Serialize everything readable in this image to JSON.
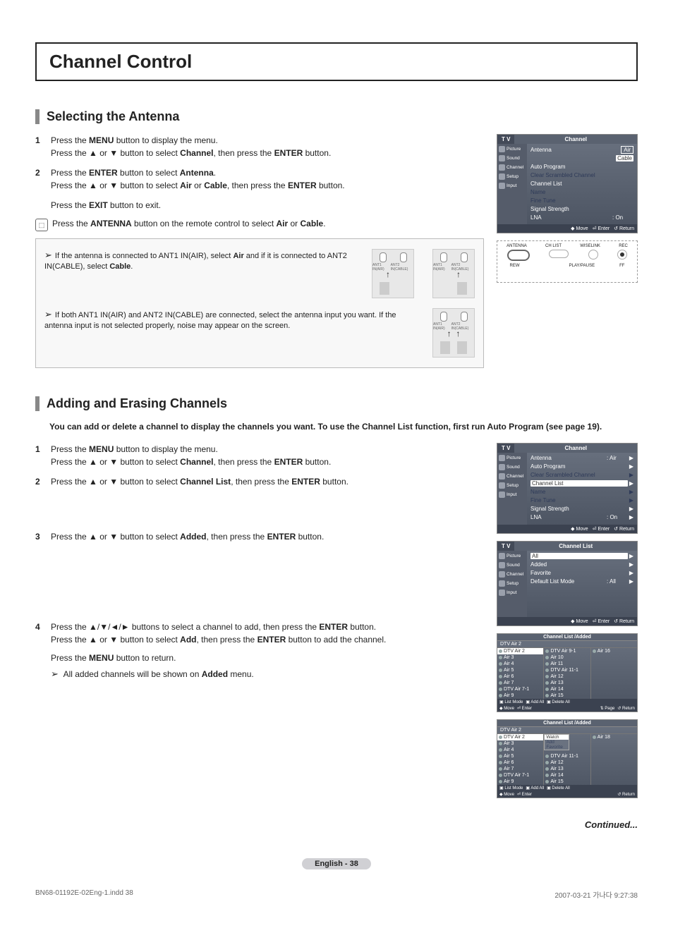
{
  "page": {
    "title": "Channel Control",
    "continued": "Continued...",
    "pagenum": "English - 38",
    "footer_left": "BN68-01192E-02Eng-1.indd   38",
    "footer_right": "2007-03-21   가나다 9:27:38"
  },
  "section1": {
    "heading": "Selecting the Antenna",
    "steps": [
      {
        "n": "1",
        "body": "Press the <b>MENU</b> button to display the menu.<br>Press the ▲ or ▼ button to select <b>Channel</b>, then press the <b>ENTER</b> button."
      },
      {
        "n": "2",
        "body": "Press the <b>ENTER</b> button to select <b>Antenna</b>.<br>Press the ▲ or ▼ button to select <b>Air</b> or <b>Cable</b>, then press the <b>ENTER</b> button."
      }
    ],
    "exit": "Press the <b>EXIT</b> button to exit.",
    "remote_note": "Press the <b>ANTENNA</b> button on the remote control to select <b>Air</b> or <b>Cable</b>.",
    "hint1": "If the antenna is connected to ANT1 IN(AIR), select <b>Air</b> and if it is connected to ANT2 IN(CABLE), select <b>Cable</b>.",
    "hint2": "If both ANT1 IN(AIR) and ANT2 IN(CABLE) are connected, select the antenna input you want. If the antenna input is not selected properly, noise may appear on the screen.",
    "osd": {
      "tv": "T V",
      "title": "Channel",
      "side": [
        "Picture",
        "Sound",
        "Channel",
        "Setup",
        "Input"
      ],
      "antenna": "Antenna",
      "air": "Air",
      "cable": "Cable",
      "autoprog": "Auto Program",
      "clear": "Clear Scrambled Channel",
      "chlist": "Channel List",
      "name": "Name",
      "finetune": "Fine Tune",
      "signal": "Signal Strength",
      "lna": "LNA",
      "on": ": On",
      "foot_move": "Move",
      "foot_enter": "Enter",
      "foot_return": "Return"
    },
    "remote_labels": {
      "ant": "ANTENNA",
      "chlist": "CH LIST",
      "wise": "WISELINK",
      "rec": "REC",
      "rew": "REW",
      "play": "PLAY/PAUSE",
      "ff": "FF"
    },
    "ant1": "ANT1 IN(AIR)",
    "ant2": "ANT2 IN(CABLE)"
  },
  "section2": {
    "heading": "Adding and Erasing Channels",
    "intro": "You can add or delete a channel to display the channels you want. To use the Channel List function, first run Auto Program (see page 19).",
    "steps": [
      {
        "n": "1",
        "body": "Press the <b>MENU</b> button to display the menu.<br>Press the ▲ or ▼ button to select <b>Channel</b>, then press the <b>ENTER</b> button."
      },
      {
        "n": "2",
        "body": "Press the ▲ or ▼ button to select <b>Channel List</b>, then press the <b>ENTER</b> button."
      },
      {
        "n": "3",
        "body": "Press the ▲ or ▼ button to select <b>Added</b>, then press the <b>ENTER</b> button."
      },
      {
        "n": "4",
        "body": "Press the ▲/▼/◄/► buttons to select a channel to add, then press the <b>ENTER</b> button.<br>Press the ▲ or ▼ button to select <b>Add</b>, then press the <b>ENTER</b> button to add the channel."
      }
    ],
    "menu_return": "Press the <b>MENU</b> button to return.",
    "note": "All added channels will be shown on <b>Added</b> menu.",
    "osd1": {
      "tv": "T V",
      "title": "Channel",
      "antenna": "Antenna",
      "air": ": Air",
      "autoprog": "Auto Program",
      "clear": "Clear Scrambled Channel",
      "chlist": "Channel List",
      "name": "Name",
      "finetune": "Fine Tune",
      "signal": "Signal Strength",
      "lna": "LNA",
      "on": ": On"
    },
    "osd2": {
      "tv": "T V",
      "title": "Channel List",
      "all": "All",
      "added": "Added",
      "fav": "Favorite",
      "dlm": "Default List Mode",
      "dlm_val": ": All"
    },
    "chlist1": {
      "title": "Channel List /Added",
      "sub": "DTV Air 2",
      "col1": [
        "DTV Air 2",
        "Air 3",
        "Air 4",
        "Air 5",
        "Air 6",
        "Air 7",
        "DTV Air 7-1",
        "Air 9"
      ],
      "col2": [
        "DTV Air 9-1",
        "Air 10",
        "Air 11",
        "DTV Air 11-1",
        "Air 12",
        "Air 13",
        "Air 14",
        "Air 15"
      ],
      "col3": [
        "Air 16",
        "",
        "",
        "",
        "",
        "",
        "",
        ""
      ],
      "foot": {
        "listmode": "List Mode",
        "addall": "Add All",
        "delall": "Delete All",
        "move": "Move",
        "enter": "Enter",
        "page": "Page",
        "return": "Return"
      }
    },
    "chlist2": {
      "title": "Channel List /Added",
      "sub": "DTV Air 2",
      "col1": [
        "DTV Air 2",
        "Air 3",
        "Air 4",
        "Air 5",
        "Air 6",
        "Air 7",
        "DTV Air 7-1",
        "Air 9"
      ],
      "popup": [
        "Watch",
        "Add",
        "Favorite"
      ],
      "col2": [
        "",
        "",
        "",
        "DTV Air 11-1",
        "Air 12",
        "Air 13",
        "Air 14",
        "Air 15"
      ],
      "col3": [
        "Air 18",
        "",
        "",
        "",
        "",
        "",
        "",
        ""
      ],
      "foot": {
        "listmode": "List Mode",
        "addall": "Add All",
        "delall": "Delete All",
        "move": "Move",
        "enter": "Enter",
        "return": "Return"
      }
    }
  },
  "chart_data": null
}
